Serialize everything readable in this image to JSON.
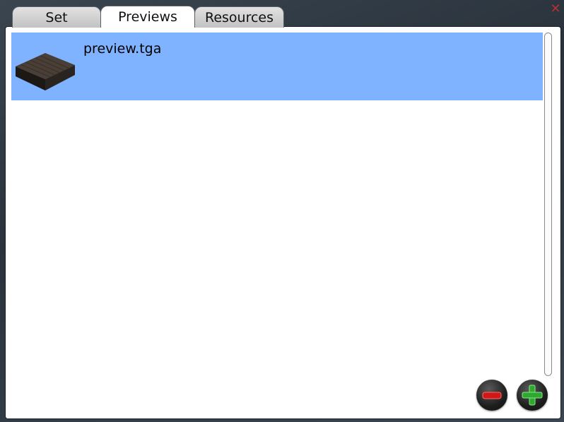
{
  "tabs": [
    {
      "label": "Set"
    },
    {
      "label": "Previews"
    },
    {
      "label": "Resources"
    }
  ],
  "active_tab": "Previews",
  "list": {
    "items": [
      {
        "label": "preview.tga",
        "selected": true
      }
    ]
  },
  "colors": {
    "selection": "#80b3ff",
    "remove": "#d01818",
    "add": "#2ea82e"
  },
  "icons": [
    "close-icon",
    "minus-icon",
    "plus-icon",
    "preview-thumbnail"
  ]
}
